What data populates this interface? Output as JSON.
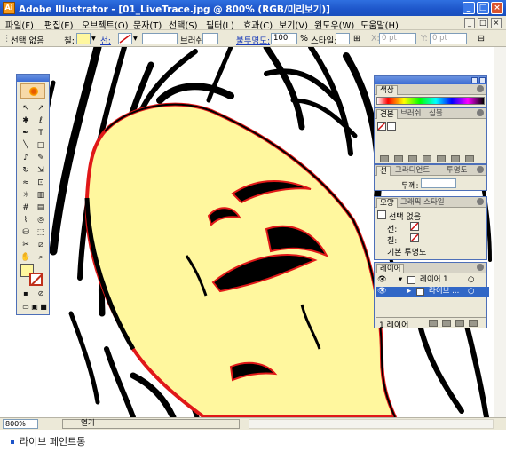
{
  "window": {
    "title": "Adobe Illustrator - [01_LiveTrace.jpg @ 800% (RGB/미리보기)]",
    "app_icon": "Ai",
    "controls": {
      "minimize": "_",
      "maximize": "□",
      "close": "×"
    }
  },
  "menu": {
    "items": [
      "파일(F)",
      "편집(E)",
      "오브젝트(O)",
      "문자(T)",
      "선택(S)",
      "필터(L)",
      "효과(C)",
      "보기(V)",
      "윈도우(W)",
      "도움말(H)"
    ],
    "doc_controls": {
      "minimize": "_",
      "restore": "□",
      "close": "×"
    }
  },
  "control_bar": {
    "selection": "선택 없음",
    "fill_label": "칠:",
    "stroke_label": "선:",
    "brush_label": "브러쉬:",
    "opacity_label": "불투명도:",
    "opacity_value": "100",
    "opacity_unit": "%",
    "style_label": "스타일:",
    "x_label": "X:",
    "x_value": "0 pt",
    "y_label": "Y:",
    "y_value": "0 pt",
    "fill_color": "#fff79e",
    "stroke_color": "#ffffff"
  },
  "status_bar": {
    "zoom": "800%",
    "status_text": "열기"
  },
  "caption": "라이브 페인트통",
  "tools": [
    {
      "name": "selection-tool",
      "glyph": "↖"
    },
    {
      "name": "direct-selection-tool",
      "glyph": "↗"
    },
    {
      "name": "magic-wand-tool",
      "glyph": "✱"
    },
    {
      "name": "lasso-tool",
      "glyph": "ℓ"
    },
    {
      "name": "pen-tool",
      "glyph": "✒"
    },
    {
      "name": "type-tool",
      "glyph": "T"
    },
    {
      "name": "line-tool",
      "glyph": "╲"
    },
    {
      "name": "rectangle-tool",
      "glyph": "□"
    },
    {
      "name": "paintbrush-tool",
      "glyph": "♪"
    },
    {
      "name": "pencil-tool",
      "glyph": "✎"
    },
    {
      "name": "rotate-tool",
      "glyph": "↻"
    },
    {
      "name": "scale-tool",
      "glyph": "⇲"
    },
    {
      "name": "warp-tool",
      "glyph": "≈"
    },
    {
      "name": "free-transform-tool",
      "glyph": "⊡"
    },
    {
      "name": "symbol-sprayer-tool",
      "glyph": "☼"
    },
    {
      "name": "column-graph-tool",
      "glyph": "▥"
    },
    {
      "name": "mesh-tool",
      "glyph": "#"
    },
    {
      "name": "gradient-tool",
      "glyph": "▤"
    },
    {
      "name": "eyedropper-tool",
      "glyph": "⌇"
    },
    {
      "name": "blend-tool",
      "glyph": "◎"
    },
    {
      "name": "live-paint-bucket-tool",
      "glyph": "⛁"
    },
    {
      "name": "live-paint-selection-tool",
      "glyph": "⬚"
    },
    {
      "name": "scissors-tool",
      "glyph": "✂"
    },
    {
      "name": "slice-tool",
      "glyph": "⧄"
    },
    {
      "name": "hand-tool",
      "glyph": "✋"
    },
    {
      "name": "zoom-tool",
      "glyph": "⌕"
    }
  ],
  "tool_colors": {
    "fill": "#fff79e",
    "stroke": "#c0301a"
  },
  "panels": {
    "color": {
      "title": "색상"
    },
    "swatches": {
      "tabs": [
        "견본",
        "브러쉬",
        "심볼"
      ]
    },
    "stroke": {
      "tabs": [
        "선",
        "그라디언트",
        "투명도"
      ],
      "weight_label": "두께:"
    },
    "appearance": {
      "tabs": [
        "모양",
        "그래픽 스타일"
      ],
      "header": "선택 없음",
      "stroke_label": "선:",
      "fill_label": "칠:",
      "default_transparency": "기본 투명도"
    },
    "layers": {
      "title": "레이어",
      "rows": [
        "레이어 1",
        "라이브 ..."
      ],
      "footer": "1 레이어"
    }
  }
}
